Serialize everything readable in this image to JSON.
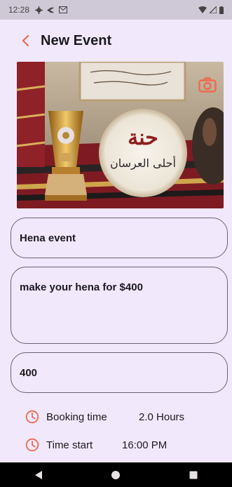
{
  "status_bar": {
    "time": "12:28"
  },
  "header": {
    "title": "New Event"
  },
  "form": {
    "title_value": "Hena event",
    "description_value": "make your hena for $400",
    "price_value": "400"
  },
  "info": {
    "booking_label": "Booking time",
    "booking_value": "2.0 Hours",
    "start_label": "Time start",
    "start_value": "16:00 PM"
  },
  "colors": {
    "accent": "#ef6a4d",
    "background": "#f1e8fb",
    "status_bar": "#cfc8d6",
    "outline": "#6b6374",
    "nav_bar": "#000000"
  },
  "icons": {
    "back": "arrow-back-icon",
    "camera": "camera-icon",
    "clock": "clock-icon"
  }
}
